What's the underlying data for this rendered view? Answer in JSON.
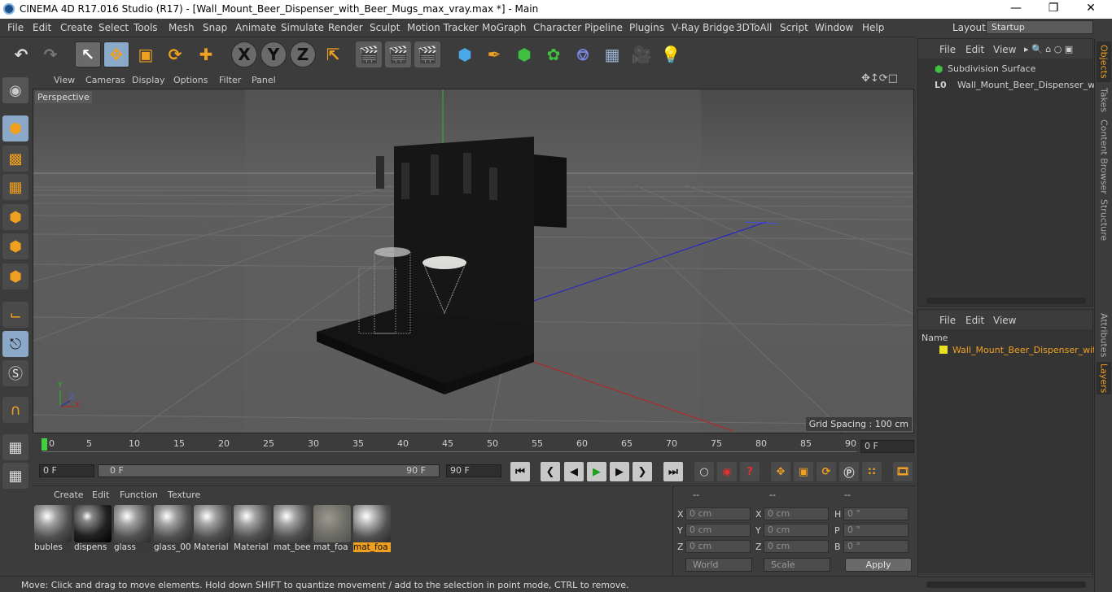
{
  "titlebar": {
    "title": "CINEMA 4D R17.016 Studio (R17) - [Wall_Mount_Beer_Dispenser_with_Beer_Mugs_max_vray.max *] - Main"
  },
  "menu": [
    "File",
    "Edit",
    "Create",
    "Select",
    "Tools",
    "Mesh",
    "Snap",
    "Animate",
    "Simulate",
    "Render",
    "Sculpt",
    "Motion Tracker",
    "MoGraph",
    "Character",
    "Pipeline",
    "Plugins",
    "V-Ray Bridge",
    "3DToAll",
    "Script",
    "Window",
    "Help"
  ],
  "layout": {
    "label": "Layout:",
    "value": "Startup"
  },
  "toolbar": {
    "axis_x": "X",
    "axis_y": "Y",
    "axis_z": "Z"
  },
  "viewport": {
    "menu": [
      "View",
      "Cameras",
      "Display",
      "Options",
      "Filter",
      "Panel"
    ],
    "camera": "Perspective",
    "grid_spacing": "Grid Spacing : 100 cm",
    "axis": {
      "x": "X",
      "y": "Y",
      "z": "Z"
    }
  },
  "timeline": {
    "ticks": [
      "0",
      "5",
      "10",
      "15",
      "20",
      "25",
      "30",
      "35",
      "40",
      "45",
      "50",
      "55",
      "60",
      "65",
      "70",
      "75",
      "80",
      "85",
      "90"
    ],
    "current_frame": "0 F"
  },
  "transport": {
    "start": "0 F",
    "range_start": "0 F",
    "range_end": "90 F",
    "end": "90 F"
  },
  "materials": {
    "menu": [
      "Create",
      "Edit",
      "Function",
      "Texture"
    ],
    "items": [
      "bubles",
      "dispens",
      "glass",
      "glass_00",
      "Material",
      "Material",
      "mat_bee",
      "mat_foa",
      "mat_foa"
    ]
  },
  "coords": {
    "headers": [
      "--",
      "--",
      "--"
    ],
    "rows": [
      {
        "a": "X",
        "av": "0 cm",
        "b": "X",
        "bv": "0 cm",
        "c": "H",
        "cv": "0 °"
      },
      {
        "a": "Y",
        "av": "0 cm",
        "b": "Y",
        "bv": "0 cm",
        "c": "P",
        "cv": "0 °"
      },
      {
        "a": "Z",
        "av": "0 cm",
        "b": "Z",
        "bv": "0 cm",
        "c": "B",
        "cv": "0 °"
      }
    ],
    "mode": "World",
    "type": "Scale",
    "apply": "Apply"
  },
  "objects": {
    "menu": [
      "File",
      "Edit",
      "View"
    ],
    "tree": [
      "Subdivision Surface",
      "Wall_Mount_Beer_Dispenser_wit"
    ]
  },
  "layers": {
    "menu": [
      "File",
      "Edit",
      "View"
    ],
    "column": "Name",
    "items": [
      "Wall_Mount_Beer_Dispenser_with"
    ]
  },
  "sidetabs": [
    "Objects",
    "Takes",
    "Content Browser",
    "Structure",
    "Attributes",
    "Layers"
  ],
  "status": "Move: Click and drag to move elements. Hold down SHIFT to quantize movement / add to the selection in point mode, CTRL to remove.",
  "colors": {
    "accent": "#f0a020",
    "viewport_bg": "#5c5c5c"
  }
}
